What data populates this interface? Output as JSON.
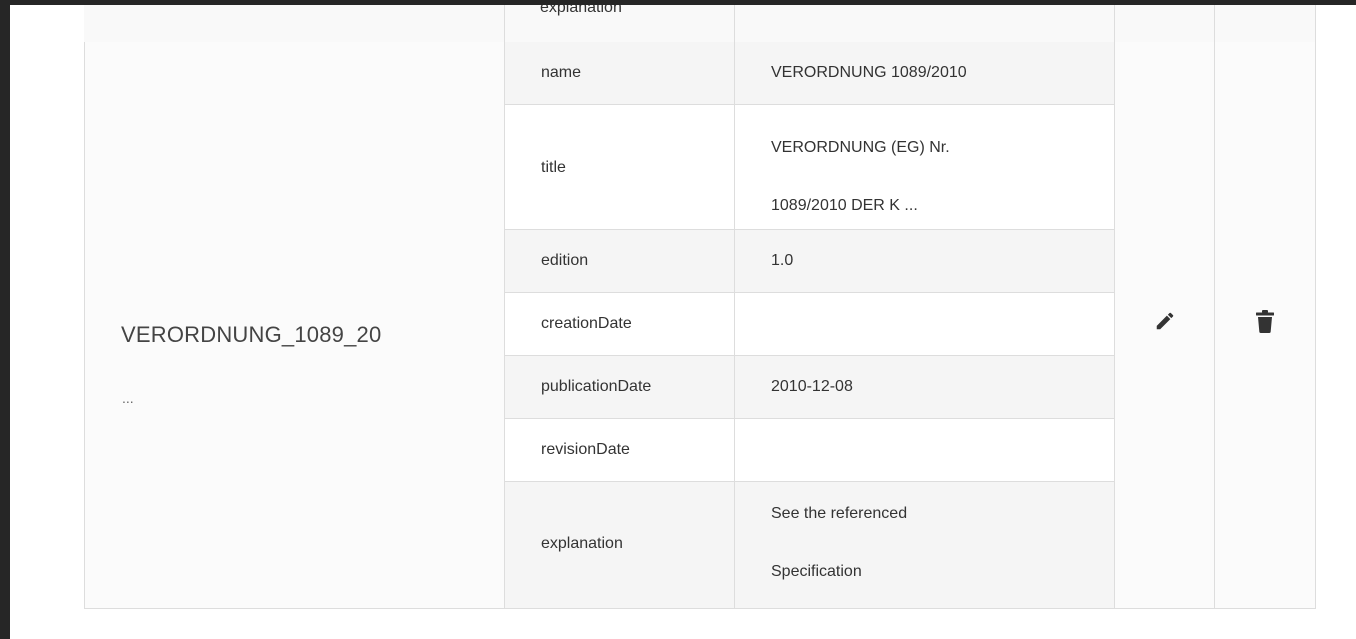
{
  "previous_row": {
    "last_key": "explanation"
  },
  "row": {
    "name": "VERORDNUNG_1089_20",
    "name_ellipsis": "...",
    "properties": [
      {
        "key": "name",
        "value": [
          "VERORDNUNG 1089/2010"
        ]
      },
      {
        "key": "title",
        "value": [
          "VERORDNUNG (EG) Nr.",
          "1089/2010 DER K ..."
        ]
      },
      {
        "key": "edition",
        "value": [
          "1.0"
        ]
      },
      {
        "key": "creationDate",
        "value": [
          ""
        ]
      },
      {
        "key": "publicationDate",
        "value": [
          "2010-12-08"
        ]
      },
      {
        "key": "revisionDate",
        "value": [
          ""
        ]
      },
      {
        "key": "explanation",
        "value": [
          "See the referenced",
          "Specification"
        ]
      }
    ],
    "actions": {
      "edit_icon": "pencil-icon",
      "delete_icon": "trash-icon"
    }
  },
  "colors": {
    "border": "#dddddd",
    "stripe": "#f5f5f5",
    "text": "#333333",
    "icon": "#333333",
    "frame": "#262626"
  }
}
